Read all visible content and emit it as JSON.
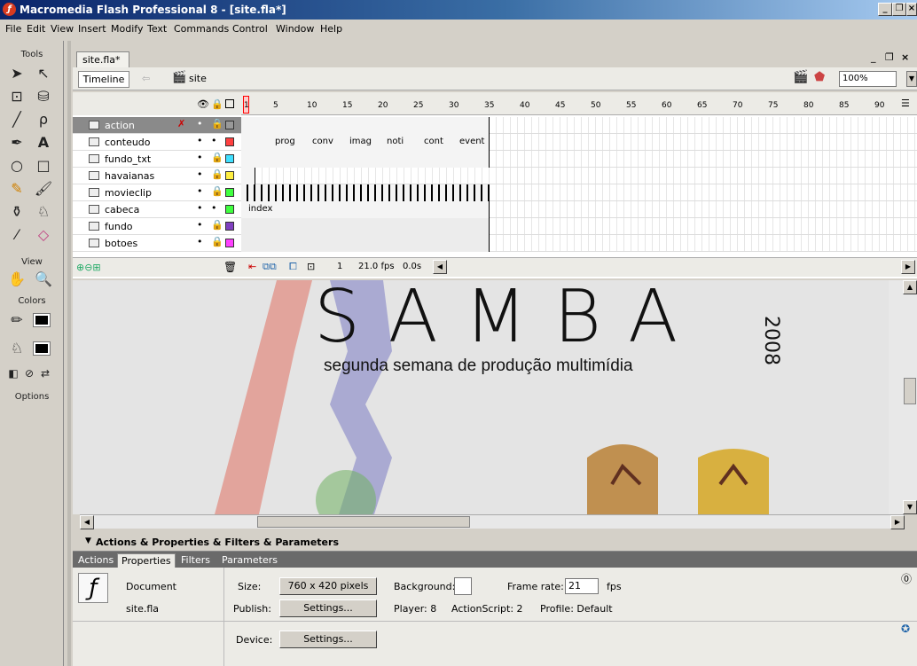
{
  "window": {
    "title": "Macromedia Flash Professional 8 - [site.fla*]"
  },
  "menus": [
    "File",
    "Edit",
    "View",
    "Insert",
    "Modify",
    "Text",
    "Commands",
    "Control",
    "Window",
    "Help"
  ],
  "tools": {
    "title": "Tools",
    "view": "View",
    "colors": "Colors",
    "options": "Options"
  },
  "document_tab": "site.fla*",
  "edit_bar": {
    "timeline_button": "Timeline",
    "scene": "site",
    "zoom": "100%"
  },
  "timeline": {
    "frame_numbers": [
      "1",
      "5",
      "10",
      "15",
      "20",
      "25",
      "30",
      "35",
      "40",
      "45",
      "50",
      "55",
      "60",
      "65",
      "70",
      "75",
      "80",
      "85",
      "90"
    ],
    "layers": [
      {
        "name": "action"
      },
      {
        "name": "conteudo"
      },
      {
        "name": "fundo_txt"
      },
      {
        "name": "havaianas"
      },
      {
        "name": "movieclip"
      },
      {
        "name": "cabeca"
      },
      {
        "name": "fundo"
      },
      {
        "name": "botoes"
      }
    ],
    "frame_labels": {
      "prog": "prog",
      "conv": "conv",
      "imag": "imag",
      "noti": "noti",
      "cont": "cont",
      "event": "event",
      "index": "index"
    },
    "current_frame": "1",
    "fps": "21.0 fps",
    "time": "0.0s"
  },
  "stage": {
    "logo_text": "SAMBA",
    "year": "2008",
    "subtitle": "segunda semana de produção multimídia"
  },
  "panel": {
    "header": "Actions & Properties & Filters & Parameters",
    "tabs": [
      "Actions",
      "Properties",
      "Filters",
      "Parameters"
    ],
    "doc_type": "Document",
    "doc_name": "site.fla",
    "size_label": "Size:",
    "size_value": "760 x 420 pixels",
    "background_label": "Background:",
    "frame_rate_label": "Frame rate:",
    "frame_rate_value": "21",
    "fps_label": "fps",
    "publish_label": "Publish:",
    "settings_label": "Settings...",
    "player_label": "Player: 8",
    "actionscript_label": "ActionScript: 2",
    "profile_label": "Profile: Default",
    "device_label": "Device:",
    "device_settings_label": "Settings..."
  },
  "colors": {
    "titlebar": "#0a246a",
    "playhead": "#ff0000"
  }
}
